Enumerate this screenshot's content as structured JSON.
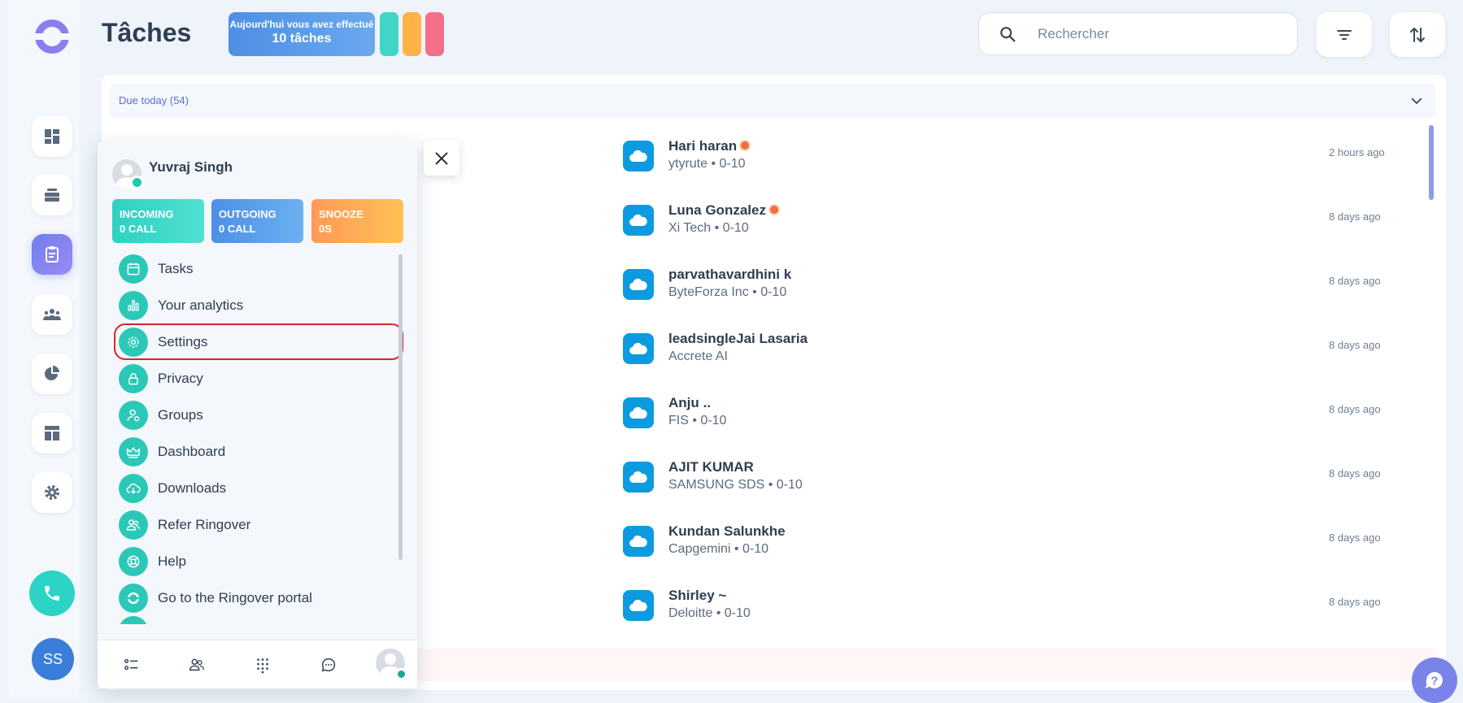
{
  "header": {
    "title": "Tâches",
    "done_line1": "Aujourd'hui vous avez effectué",
    "done_line2": "10 tâches",
    "search_placeholder": "Rechercher"
  },
  "colors": {
    "pill_teal": "#3fd6c6",
    "pill_orange": "#ffb347",
    "pill_pink": "#f56f8a",
    "accent": "#7a84e8",
    "salesforce": "#0c9be0"
  },
  "rail": {
    "icons": [
      "logo-icon",
      "dashboard-icon",
      "inbox-icon",
      "tasks-icon",
      "team-icon",
      "pie-chart-icon",
      "layout-icon",
      "gear-icon",
      "phone-icon"
    ],
    "avatar_initials": "SS"
  },
  "section": {
    "label": "Due today (54)"
  },
  "tasks": [
    {
      "name": "Hari haran",
      "sub": "ytyrute • 0-10",
      "time": "2 hours ago",
      "badge": true
    },
    {
      "name": "Luna Gonzalez",
      "sub": "Xi Tech • 0-10",
      "time": "8 days ago",
      "badge": true
    },
    {
      "name": "parvathavardhini k",
      "sub": "ByteForza Inc • 0-10",
      "time": "8 days ago",
      "badge": false
    },
    {
      "name": "leadsingleJai Lasaria",
      "sub": "Accrete AI",
      "time": "8 days ago",
      "badge": false
    },
    {
      "name": "Anju ..",
      "sub": "FIS • 0-10",
      "time": "8 days ago",
      "badge": false
    },
    {
      "name": "AJIT KUMAR",
      "sub": "SAMSUNG SDS • 0-10",
      "time": "8 days ago",
      "badge": false
    },
    {
      "name": "Kundan Salunkhe",
      "sub": "Capgemini • 0-10",
      "time": "8 days ago",
      "badge": false
    },
    {
      "name": "Shirley ~",
      "sub": "Deloitte • 0-10",
      "time": "8 days ago",
      "badge": false
    }
  ],
  "menu": {
    "user_name": "Yuvraj Singh",
    "stats": [
      {
        "line1": "INCOMING",
        "line2": "0 CALL"
      },
      {
        "line1": "OUTGOING",
        "line2": "0 CALL"
      },
      {
        "line1": "SNOOZE",
        "line2": "0S"
      }
    ],
    "items": [
      {
        "label": "Tasks",
        "icon": "calendar-icon"
      },
      {
        "label": "Your analytics",
        "icon": "bar-chart-icon"
      },
      {
        "label": "Settings",
        "icon": "gear-icon"
      },
      {
        "label": "Privacy",
        "icon": "lock-icon"
      },
      {
        "label": "Groups",
        "icon": "user-group-icon"
      },
      {
        "label": "Dashboard",
        "icon": "crown-icon"
      },
      {
        "label": "Downloads",
        "icon": "cloud-download-icon"
      },
      {
        "label": "Refer Ringover",
        "icon": "users-icon"
      },
      {
        "label": "Help",
        "icon": "lifebuoy-icon"
      },
      {
        "label": "Go to the Ringover portal",
        "icon": "ringover-icon"
      }
    ],
    "footer_icons": [
      "list-icon",
      "contacts-icon",
      "dialpad-icon",
      "chat-icon",
      "profile-icon"
    ]
  }
}
